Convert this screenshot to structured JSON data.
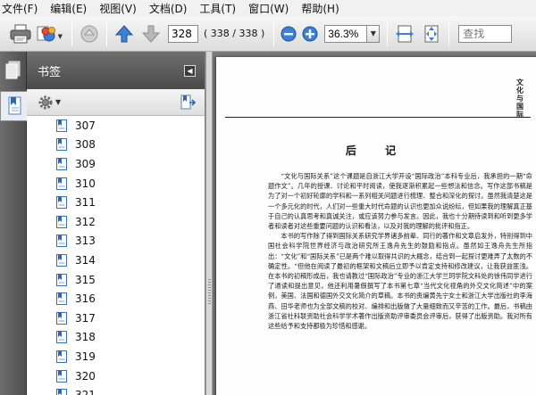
{
  "menu": {
    "items": [
      "文件(F)",
      "编辑(E)",
      "视图(V)",
      "文档(D)",
      "工具(T)",
      "窗口(W)",
      "帮助(H)"
    ]
  },
  "toolbar": {
    "page_number": "328",
    "page_count": "( 338 / 338 )",
    "zoom": "36.3%",
    "search_placeholder": "查找"
  },
  "panel": {
    "title": "书签",
    "bookmarks": [
      "307",
      "308",
      "309",
      "310",
      "311",
      "312",
      "313",
      "314",
      "315",
      "316",
      "317",
      "318",
      "319",
      "320",
      "321"
    ]
  },
  "document": {
    "running_head_mark": "文化与国际",
    "title": "后 记",
    "paragraphs": [
      "“文化与国际关系”这个课题是自浙江大学开设“国际政治”本科专业后，我承担的一期“命题作文”。几年的授课、讨论和平时阅读，使我逐渐积累起一些想法和信念。写作这部书稿是为了对一个初好轮廓的学科和一系列相关问题进行梳理、整合和深化的探讨。虽然我清楚这是一个多元化的时代，人们对一些重大时代命题的认识也更加众说纷纭，但如果我的理解真正基于自己的认真思考和真诚关注，或应该努力参与发言。因此，我也十分期待读到和听到更多学者和读者对这些重要问题的认识和看法，以及对我的理解的批评和指正。",
      "本书的写作除了得到国际关系研究学界诸多前辈、同行的著作和文章启发外，特别得到中国社会科学院世界经济与政治研究所王逸舟先生的鼓励和指点。虽然如王逸舟先生所指出：“文化”和“国际关系”已是两个难以取得共识的大概念，结合到一起探讨更难弄了太数的不确定性。“但他在阅读了最初的框架和文稿后立即予以肯定支持和修改建议，让我获益匪浅。在本书的初稿形成后，我也请教过“国际政治”专业的浙江大学兰珂学院文科处的徐伟同学进行了通读和提出意见，他还利用暑假撰写了本书第七章“当代文化视角的外交文化简述”中的案例，美国、法国和德国外交文化简介的草稿。本书的责编黄先宁女士和浙江大学出版社的李海燕、田华老师也为全部文稿的校对、编排和出版做了大量细致而又辛苦的工作。最后，书稿由浙江省社科联资助社会科学学术著作出版资助评审委员会评审后，获得了出版资助。我对所有这些给予和支持都极为珍惜和感谢。"
    ]
  }
}
